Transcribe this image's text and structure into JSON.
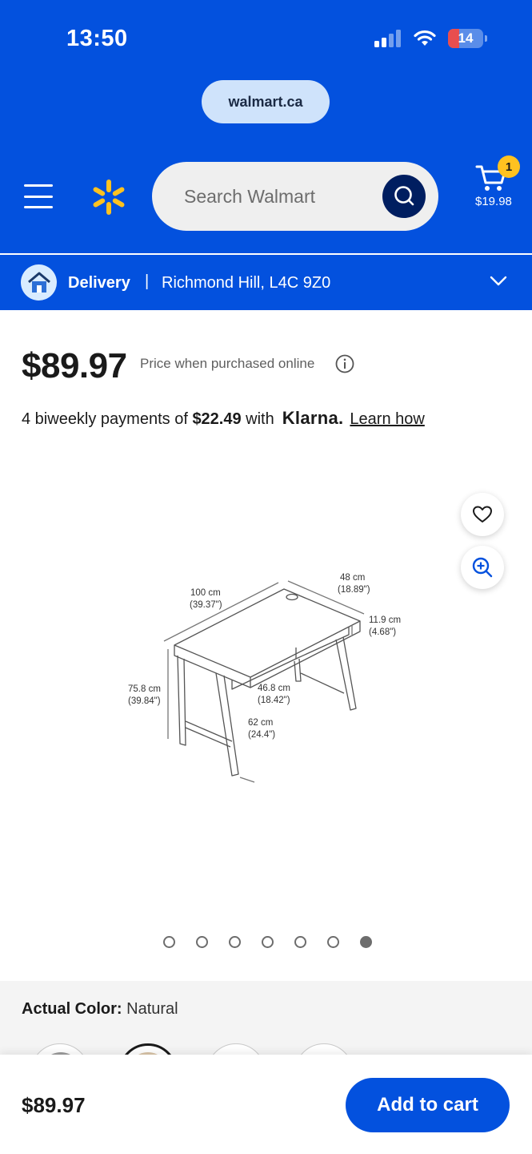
{
  "status_bar": {
    "time": "13:50",
    "battery": "14",
    "battery_level": 0.14
  },
  "browser": {
    "url": "walmart.ca"
  },
  "header": {
    "search_placeholder": "Search Walmart",
    "cart_count": "1",
    "cart_total": "$19.98"
  },
  "delivery": {
    "label": "Delivery",
    "separator": "|",
    "location": "Richmond Hill, L4C 9Z0"
  },
  "product": {
    "price": "$89.97",
    "price_note": "Price when purchased online",
    "klarna_prefix": "4 biweekly payments of ",
    "klarna_amount": "$22.49",
    "klarna_with": " with",
    "klarna_brand": "Klarna.",
    "learn_how": "Learn how"
  },
  "image_labels": {
    "width": "100 cm",
    "width_in": "(39.37\")",
    "depth": "48 cm",
    "depth_in": "(18.89\")",
    "drawer": "11.9 cm",
    "drawer_in": "(4.68\")",
    "height": "75.8 cm",
    "height_in": "(39.84\")",
    "inner": "46.8 cm",
    "inner_in": "(18.42\")",
    "leg": "62 cm",
    "leg_in": "(24.4\")"
  },
  "carousel": {
    "count": 7,
    "active_index": 6
  },
  "color": {
    "label": "Actual Color:",
    "value": "Natural"
  },
  "bottom_bar": {
    "price": "$89.97",
    "add_to_cart": "Add to cart"
  },
  "colors": {
    "walmart_blue": "#0351de",
    "spark_yellow": "#ffc220",
    "navy": "#001e60"
  }
}
